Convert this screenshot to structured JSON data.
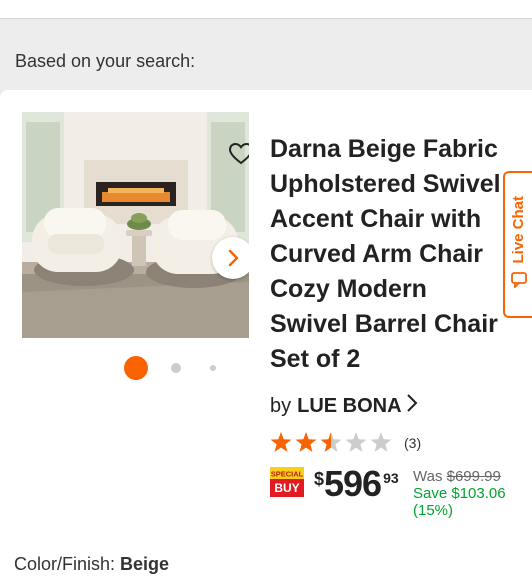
{
  "section": {
    "heading": "Based on your search:"
  },
  "product": {
    "title": "Darna Beige Fabric\nUpholstered Swivel\nAccent Chair with\nCurved Arm Chair\nCozy Modern\nSwivel Barrel Chair\nSet of 2",
    "by_label": "by",
    "brand": "LUE BONA",
    "rating": {
      "stars": 2.5,
      "max_stars": 5,
      "count_label": "(3)"
    },
    "price": {
      "currency": "$",
      "dollars": "596",
      "cents": "93",
      "was_label": "Was",
      "was_price": "$699.99",
      "save_label": "Save $103.06",
      "save_percent": "(15%)"
    },
    "badge": {
      "line1": "SPECIAL",
      "line2": "BUY"
    },
    "color_finish": {
      "label": "Color/Finish:",
      "value": "Beige"
    },
    "carousel": {
      "active_index": 1,
      "total_dots": 3
    }
  },
  "live_chat": {
    "label": "Live Chat"
  },
  "colors": {
    "accent": "#f96302",
    "save_green": "#00a330",
    "star_filled": "#f96302",
    "star_empty": "#cccccc"
  },
  "icons": {
    "favorite": "heart-icon",
    "next": "chevron-right-icon",
    "brand_chevron": "chevron-right-icon",
    "chat": "chat-bubble-icon"
  }
}
